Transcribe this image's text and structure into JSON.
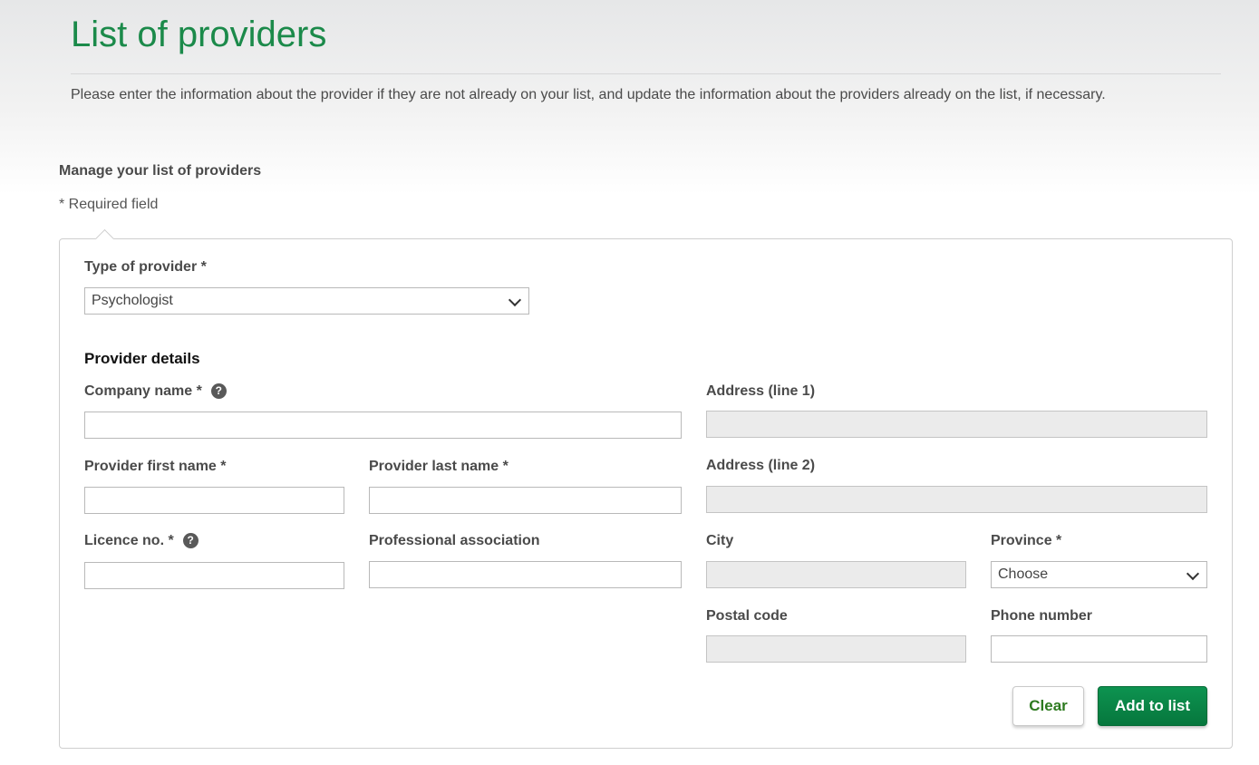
{
  "page": {
    "title": "List of providers",
    "intro": "Please enter the information about the provider if they are not already on your list, and update the information about the providers already on the list, if necessary."
  },
  "section": {
    "title": "Manage your list of providers",
    "required_note": "* Required field"
  },
  "form": {
    "type_of_provider": {
      "label": "Type of provider *",
      "value": "Psychologist"
    },
    "provider_details_heading": "Provider details",
    "company_name": {
      "label": "Company name *",
      "value": ""
    },
    "first_name": {
      "label": "Provider first name *",
      "value": ""
    },
    "last_name": {
      "label": "Provider last name *",
      "value": ""
    },
    "licence_no": {
      "label": "Licence no. *",
      "value": ""
    },
    "professional_association": {
      "label": "Professional association",
      "value": ""
    },
    "address_line1": {
      "label": "Address (line 1)",
      "value": "",
      "disabled": true
    },
    "address_line2": {
      "label": "Address (line 2)",
      "value": "",
      "disabled": true
    },
    "city": {
      "label": "City",
      "value": "",
      "disabled": true
    },
    "province": {
      "label": "Province *",
      "value": "Choose"
    },
    "postal_code": {
      "label": "Postal code",
      "value": "",
      "disabled": true
    },
    "phone_number": {
      "label": "Phone number",
      "value": ""
    },
    "help_icon_glyph": "?"
  },
  "buttons": {
    "clear": "Clear",
    "add": "Add to list"
  },
  "colors": {
    "accent_green": "#1b8a4a",
    "button_green": "#06773d",
    "clear_text": "#2d7a1f"
  }
}
